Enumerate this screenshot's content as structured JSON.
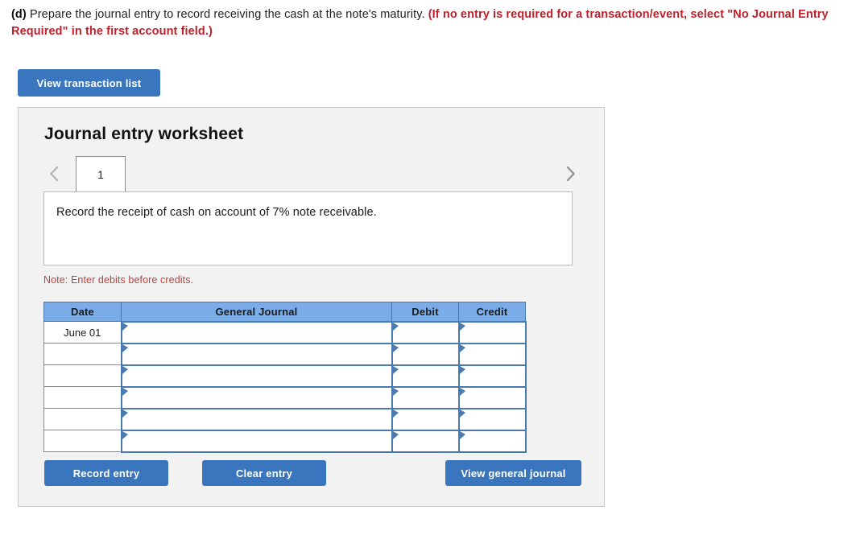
{
  "prompt": {
    "label": "(d)",
    "text": " Prepare the journal entry to record receiving the cash at the note's maturity. ",
    "warning": "(If no entry is required for a transaction/event, select \"No Journal Entry Required\" in the first account field.)"
  },
  "toolbar": {
    "view_transaction_list": "View transaction list"
  },
  "panel": {
    "title": "Journal entry worksheet",
    "tabs": [
      {
        "label": "1",
        "active": true
      }
    ],
    "nav": {
      "prev_icon": "chevron-left-icon",
      "next_icon": "chevron-right-icon"
    },
    "description": "Record the receipt of cash on account of 7% note receivable.",
    "note": "Note: Enter debits before credits."
  },
  "table": {
    "headers": [
      "Date",
      "General Journal",
      "Debit",
      "Credit"
    ],
    "rows": [
      {
        "date": "June 01",
        "general_journal": "",
        "debit": "",
        "credit": ""
      },
      {
        "date": "",
        "general_journal": "",
        "debit": "",
        "credit": ""
      },
      {
        "date": "",
        "general_journal": "",
        "debit": "",
        "credit": ""
      },
      {
        "date": "",
        "general_journal": "",
        "debit": "",
        "credit": ""
      },
      {
        "date": "",
        "general_journal": "",
        "debit": "",
        "credit": ""
      },
      {
        "date": "",
        "general_journal": "",
        "debit": "",
        "credit": ""
      }
    ]
  },
  "actions": {
    "record_entry": "Record entry",
    "clear_entry": "Clear entry",
    "view_general_journal": "View general journal"
  },
  "colors": {
    "button_blue": "#3a76bd",
    "header_blue": "#7aade8",
    "warning_red": "#c0202a",
    "note_red": "#b5453f",
    "panel_bg": "#f2f2f2",
    "cell_border_blue": "#4a7ab0"
  }
}
